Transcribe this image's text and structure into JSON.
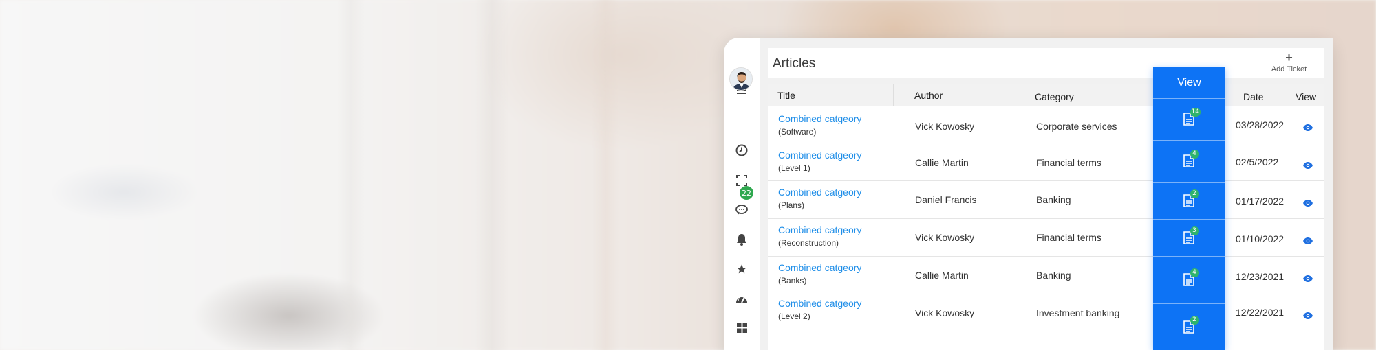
{
  "sidebar": {
    "items": [
      {
        "icon": "hamburger-menu-icon"
      },
      {
        "icon": "avatar"
      },
      {
        "icon": "clock-icon"
      },
      {
        "icon": "fullscreen-icon"
      },
      {
        "icon": "chat-bubble-icon"
      },
      {
        "icon": "bell-icon",
        "badge": "22"
      },
      {
        "icon": "star-icon"
      },
      {
        "icon": "dashboard-gauge-icon"
      },
      {
        "icon": "grid-icon"
      },
      {
        "icon": "user-icon"
      }
    ]
  },
  "header": {
    "title": "Articles",
    "add_ticket_icon": "+",
    "add_ticket_label": "Add Ticket"
  },
  "table": {
    "columns": {
      "title": "Title",
      "author": "Author",
      "category": "Category",
      "view_highlight": "View",
      "date": "Date",
      "view": "View"
    },
    "rows": [
      {
        "title": "Combined catgeory",
        "sub": "(Software)",
        "author": "Vick Kowosky",
        "category": "Corporate services",
        "count": "14",
        "date": "03/28/2022"
      },
      {
        "title": "Combined catgeory",
        "sub": "(Level 1)",
        "author": "Callie Martin",
        "category": "Financial terms",
        "count": "4",
        "date": "02/5/2022"
      },
      {
        "title": "Combined catgeory",
        "sub": "(Plans)",
        "author": "Daniel Francis",
        "category": "Banking",
        "count": "2",
        "date": "01/17/2022"
      },
      {
        "title": "Combined catgeory",
        "sub": "(Reconstruction)",
        "author": "Vick Kowosky",
        "category": "Financial terms",
        "count": "3",
        "date": "01/10/2022"
      },
      {
        "title": "Combined catgeory",
        "sub": "(Banks)",
        "author": "Callie Martin",
        "category": "Banking",
        "count": "4",
        "date": "12/23/2021"
      },
      {
        "title": "Combined catgeory",
        "sub": "(Level 2)",
        "author": "Vick Kowosky",
        "category": "Investment banking",
        "count": "2",
        "date": "12/22/2021"
      }
    ]
  },
  "colors": {
    "accent_blue": "#0d73f5",
    "link_blue": "#1f8ee8",
    "badge_green": "#2fa84f"
  }
}
